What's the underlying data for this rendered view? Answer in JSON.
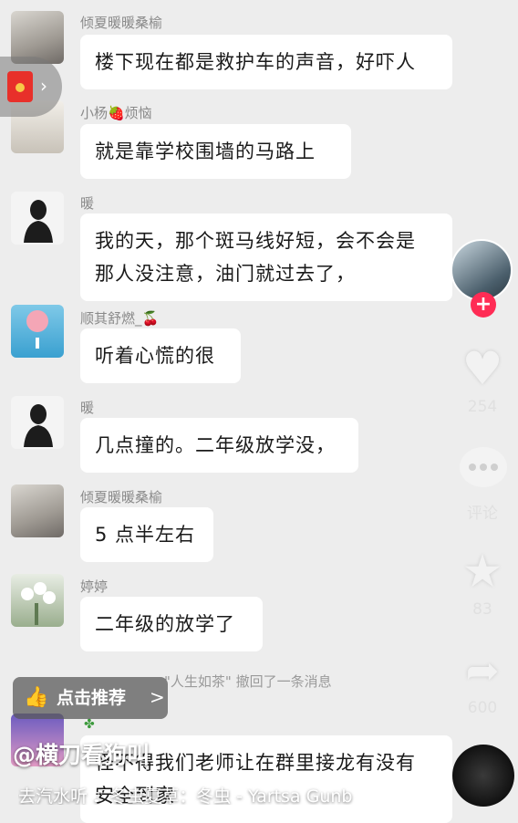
{
  "messages": [
    {
      "name": "倾夏暖暖桑榆",
      "text": "楼下现在都是救护车的声音，好吓人"
    },
    {
      "name": "小杨🍓烦恼",
      "text": "就是靠学校围墙的马路上"
    },
    {
      "name": "暖",
      "text": "我的天，那个斑马线好短，会不会是\n那人没注意，油门就过去了，"
    },
    {
      "name": "顺其舒燃_🍒",
      "text": "听着心慌的很"
    },
    {
      "name": "暖",
      "text": "几点撞的。二年级放学没，"
    },
    {
      "name": "倾夏暖暖桑榆",
      "text": "5 点半左右"
    },
    {
      "name": "婷婷",
      "text": "二年级的放学了"
    },
    {
      "name": "",
      "text": "怪不得我们老师让在群里接龙有没有\n安全到家"
    }
  ],
  "recall_notice": "\"人生如茶\" 撤回了一条消息",
  "sidebar": {
    "likes": "254",
    "comment_label": "评论",
    "favorites": "83",
    "shares": "600",
    "follow_symbol": "+"
  },
  "recommend_button": {
    "label": "点击推荐",
    "arrow": ">"
  },
  "video_author": "@横刀看狗叫",
  "music": {
    "text": "去汽水听 ♪ 冬虫夏草：冬虫 - Yartsa Gunb"
  },
  "icons": {
    "red_packet": "red-packet-icon",
    "heart": "heart-icon",
    "comment": "comment-icon",
    "star": "star-icon",
    "share": "share-icon",
    "thumb": "thumbs-up-icon"
  },
  "colors": {
    "follow": "#ff2c55",
    "bubble": "#ffffff",
    "background": "#ededed"
  }
}
